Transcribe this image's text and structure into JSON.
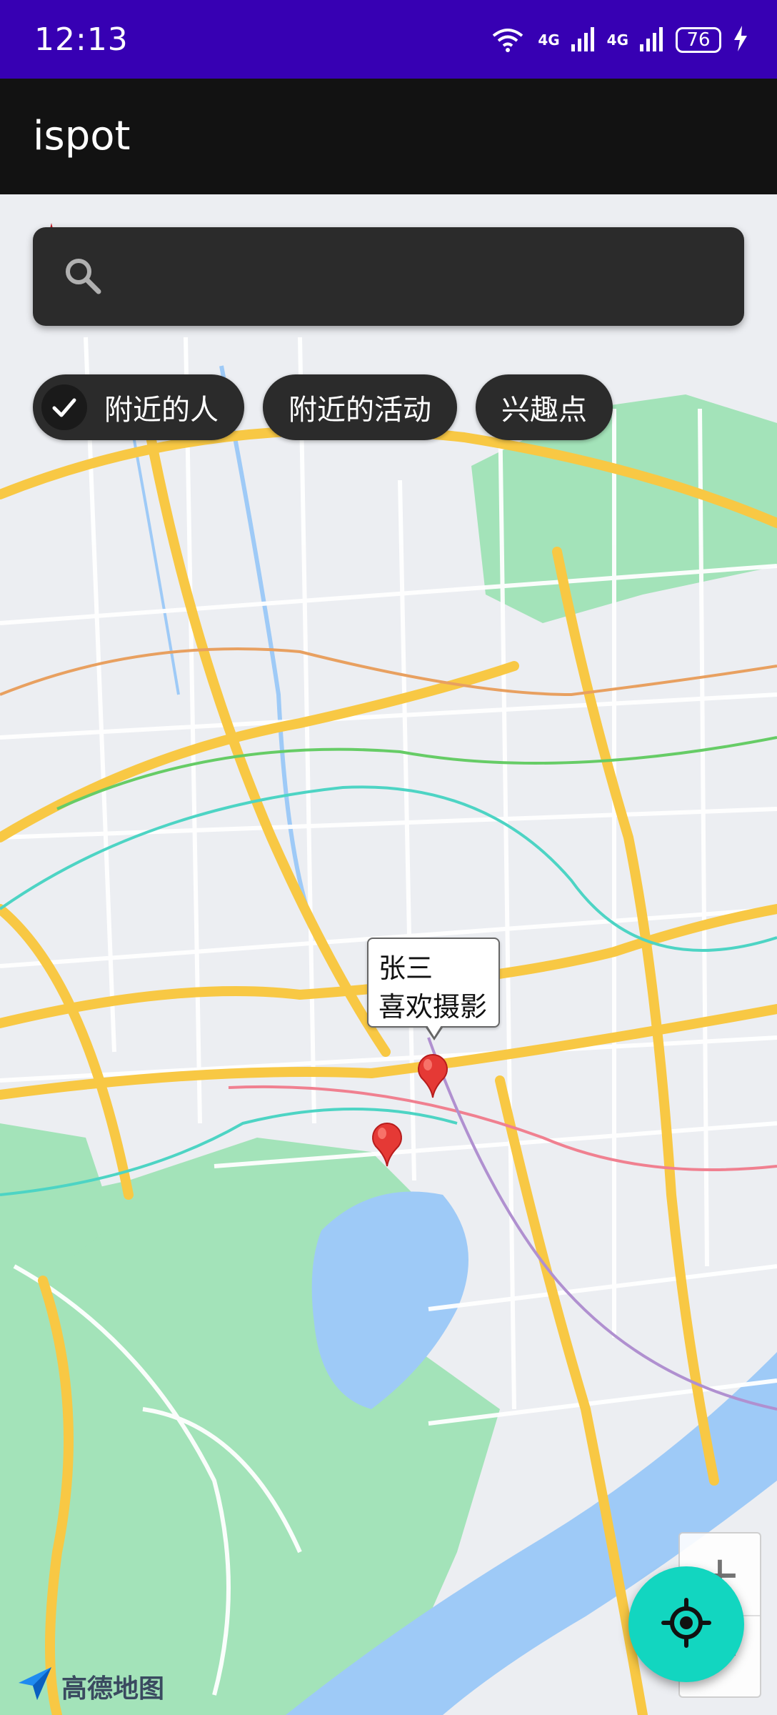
{
  "status_bar": {
    "time": "12:13",
    "wifi_badge": "6",
    "net1": "4G",
    "net2": "4G",
    "battery": "76"
  },
  "app_bar": {
    "title": "ispot"
  },
  "search": {
    "value": "",
    "placeholder": ""
  },
  "chips": [
    {
      "label": "附近的人",
      "checked": true
    },
    {
      "label": "附近的活动",
      "checked": false
    },
    {
      "label": "兴趣点",
      "checked": false
    }
  ],
  "info_window": {
    "name": "张三",
    "hobby": "喜欢摄影"
  },
  "zoom": {
    "in_label": "+",
    "out_label": "−"
  },
  "map_logo": {
    "text": "高德地图"
  },
  "colors": {
    "status_bar": "#3700b3",
    "app_bar": "#121212",
    "fab": "#12d6c0",
    "marker": "#e53935"
  }
}
